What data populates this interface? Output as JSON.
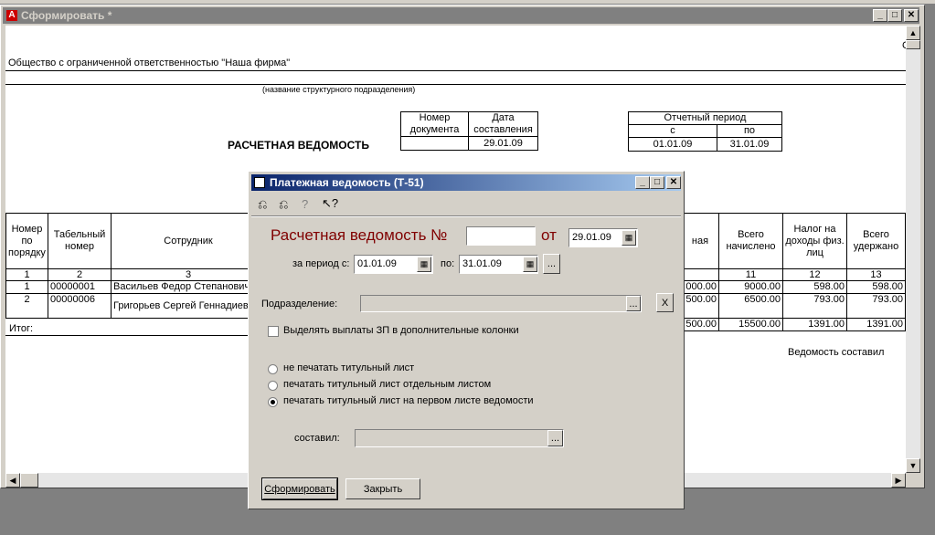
{
  "window": {
    "title": "Сформировать  *",
    "icon_char": "A"
  },
  "report": {
    "org_name": "Общество с ограниченной ответственностью \"Наша фирма\"",
    "subdivision_caption": "(название структурного подразделения)",
    "title": "РАСЧЕТНАЯ ВЕДОМОСТЬ",
    "doc_head": {
      "num": "Номер документа",
      "date": "Дата составления",
      "date_val": "29.01.09"
    },
    "period": {
      "caption": "Отчетный период",
      "from_label": "с",
      "to_label": "по",
      "from": "01.01.09",
      "to": "31.01.09"
    },
    "table": {
      "headers": [
        "Номер по порядку",
        "Табельный номер",
        "Сотрудник"
      ],
      "right_headers": [
        "ная",
        "Всего начислено",
        "Налог на доходы физ. лиц",
        "Всего удержано"
      ],
      "col_nums": [
        "1",
        "2",
        "3"
      ],
      "right_col_nums": [
        "11",
        "12",
        "13"
      ],
      "rows": [
        {
          "n": "1",
          "tab": "00000001",
          "name": "Васильев Федор Степанович",
          "c10": "000.00",
          "c11": "9000.00",
          "c12": "598.00",
          "c13": "598.00"
        },
        {
          "n": "2",
          "tab": "00000006",
          "name": "Григорьев Сергей Геннадиевич",
          "c10": "500.00",
          "c11": "6500.00",
          "c12": "793.00",
          "c13": "793.00"
        }
      ],
      "total": {
        "label": "Итог:",
        "c10": "500.00",
        "c11": "15500.00",
        "c12": "1391.00",
        "c13": "1391.00"
      }
    },
    "composed_by": "Ведомость составил",
    "edge_char": "С"
  },
  "dialog": {
    "title": "Платежная ведомость (Т-51)",
    "heading": "Расчетная ведомость №",
    "number_value": "",
    "from_word": "от",
    "date_value": "29.01.09",
    "period_label": "за период с:",
    "period_from": "01.01.09",
    "period_to_label": "по:",
    "period_to": "31.01.09",
    "ellipsis": "...",
    "subdivision_label": "Подразделение:",
    "subdivision_value": "",
    "clear_label": "X",
    "checkbox_label": "Выделять выплаты ЗП в дополнительные колонки",
    "radios": [
      {
        "label": "не печатать титульный лист",
        "selected": false
      },
      {
        "label": "печатать титульный лист отдельным листом",
        "selected": false
      },
      {
        "label": "печатать титульный лист на первом листе ведомости",
        "selected": true
      }
    ],
    "composer_label": "составил:",
    "composer_value": "",
    "generate_button": "Сформировать",
    "close_button": "Закрыть"
  },
  "colors": {
    "heading": "#800000",
    "titlebar_active": "#0a246a",
    "titlebar_inactive": "#808080"
  }
}
